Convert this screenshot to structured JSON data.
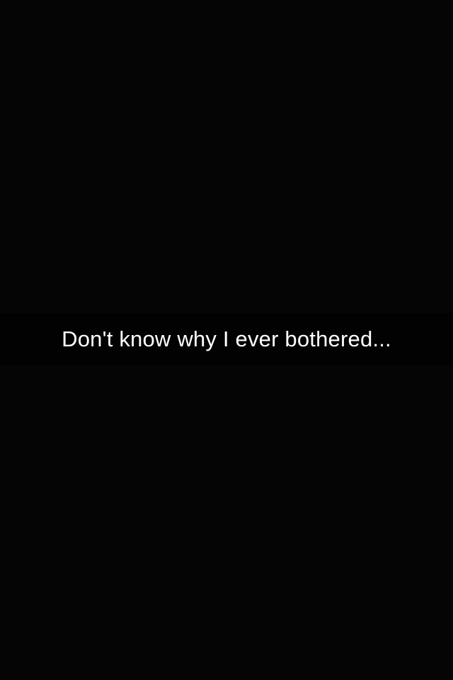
{
  "colors": {
    "background": "#050505",
    "caption_bar": "#000000",
    "caption_text": "#ffffff"
  },
  "caption": {
    "text": "Don't know why I ever bothered..."
  }
}
